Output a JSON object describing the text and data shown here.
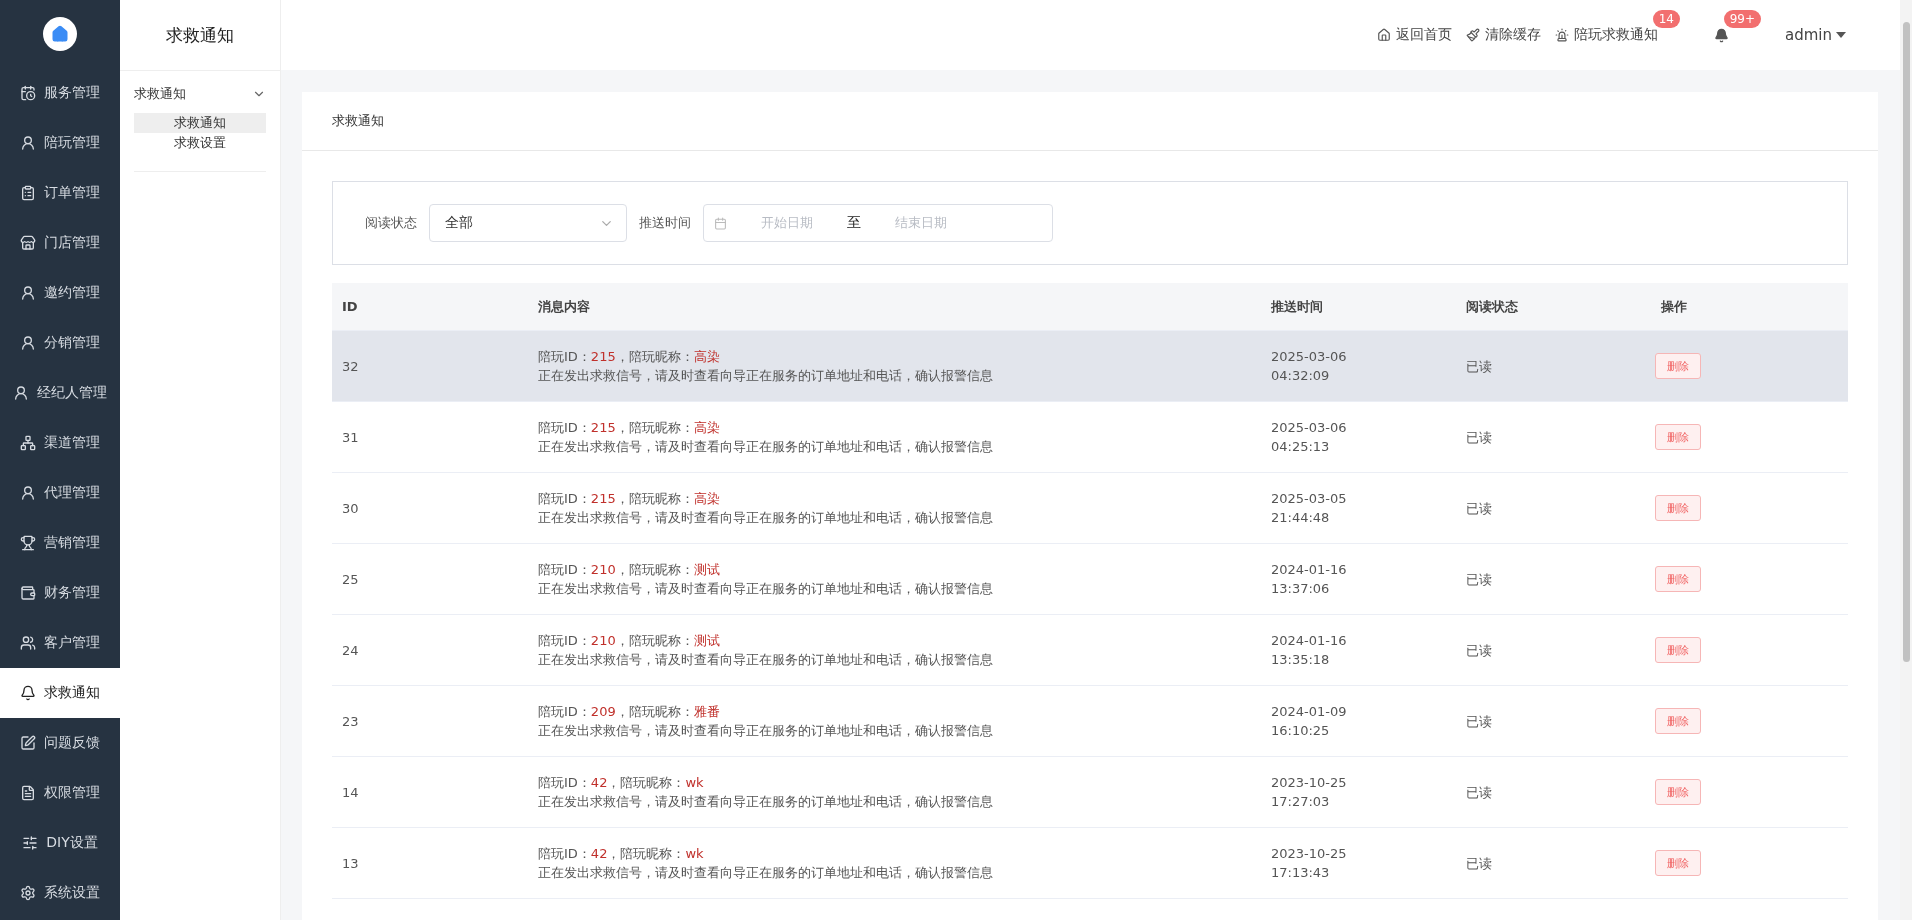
{
  "sidebar": {
    "items": [
      {
        "label": "服务管理",
        "selected": false
      },
      {
        "label": "陪玩管理",
        "selected": false
      },
      {
        "label": "订单管理",
        "selected": false
      },
      {
        "label": "门店管理",
        "selected": false
      },
      {
        "label": "邀约管理",
        "selected": false
      },
      {
        "label": "分销管理",
        "selected": false
      },
      {
        "label": "经纪人管理",
        "selected": false
      },
      {
        "label": "渠道管理",
        "selected": false
      },
      {
        "label": "代理管理",
        "selected": false
      },
      {
        "label": "营销管理",
        "selected": false
      },
      {
        "label": "财务管理",
        "selected": false
      },
      {
        "label": "客户管理",
        "selected": false
      },
      {
        "label": "求救通知",
        "selected": true
      },
      {
        "label": "问题反馈",
        "selected": false
      },
      {
        "label": "权限管理",
        "selected": false
      },
      {
        "label": "DIY设置",
        "selected": false
      },
      {
        "label": "系统设置",
        "selected": false
      }
    ]
  },
  "submenu": {
    "title": "求救通知",
    "group": {
      "label": "求救通知",
      "expanded": true,
      "children": [
        {
          "label": "求救通知",
          "selected": true
        },
        {
          "label": "求救设置",
          "selected": false
        }
      ]
    }
  },
  "header": {
    "links": [
      {
        "label": "返回首页"
      },
      {
        "label": "清除缓存"
      },
      {
        "label": "陪玩求救通知",
        "badge": "14"
      }
    ],
    "bell_badge": "99+",
    "user": "admin"
  },
  "card": {
    "title": "求救通知"
  },
  "filters": {
    "status_label": "阅读状态",
    "status_value": "全部",
    "time_label": "推送时间",
    "start_placeholder": "开始日期",
    "separator": "至",
    "end_placeholder": "结束日期"
  },
  "table": {
    "columns": [
      "ID",
      "消息内容",
      "推送时间",
      "阅读状态",
      "操作"
    ],
    "rows": [
      {
        "id": "32",
        "id_label": "陪玩ID：",
        "companion_id": "215",
        "nick_label": "，陪玩昵称：",
        "nickname": "高染",
        "message": "正在发出求救信号，请及时查看向导正在服务的订单地址和电话，确认报警信息",
        "date": "2025-03-06",
        "time": "04:32:09",
        "status": "已读",
        "action": "删除",
        "hovered": true
      },
      {
        "id": "31",
        "id_label": "陪玩ID：",
        "companion_id": "215",
        "nick_label": "，陪玩昵称：",
        "nickname": "高染",
        "message": "正在发出求救信号，请及时查看向导正在服务的订单地址和电话，确认报警信息",
        "date": "2025-03-06",
        "time": "04:25:13",
        "status": "已读",
        "action": "删除",
        "hovered": false
      },
      {
        "id": "30",
        "id_label": "陪玩ID：",
        "companion_id": "215",
        "nick_label": "，陪玩昵称：",
        "nickname": "高染",
        "message": "正在发出求救信号，请及时查看向导正在服务的订单地址和电话，确认报警信息",
        "date": "2025-03-05",
        "time": "21:44:48",
        "status": "已读",
        "action": "删除",
        "hovered": false
      },
      {
        "id": "25",
        "id_label": "陪玩ID：",
        "companion_id": "210",
        "nick_label": "，陪玩昵称：",
        "nickname": "测试",
        "message": "正在发出求救信号，请及时查看向导正在服务的订单地址和电话，确认报警信息",
        "date": "2024-01-16",
        "time": "13:37:06",
        "status": "已读",
        "action": "删除",
        "hovered": false
      },
      {
        "id": "24",
        "id_label": "陪玩ID：",
        "companion_id": "210",
        "nick_label": "，陪玩昵称：",
        "nickname": "测试",
        "message": "正在发出求救信号，请及时查看向导正在服务的订单地址和电话，确认报警信息",
        "date": "2024-01-16",
        "time": "13:35:18",
        "status": "已读",
        "action": "删除",
        "hovered": false
      },
      {
        "id": "23",
        "id_label": "陪玩ID：",
        "companion_id": "209",
        "nick_label": "，陪玩昵称：",
        "nickname": "雅番",
        "message": "正在发出求救信号，请及时查看向导正在服务的订单地址和电话，确认报警信息",
        "date": "2024-01-09",
        "time": "16:10:25",
        "status": "已读",
        "action": "删除",
        "hovered": false
      },
      {
        "id": "14",
        "id_label": "陪玩ID：",
        "companion_id": "42",
        "nick_label": "，陪玩昵称：",
        "nickname": "wk",
        "message": "正在发出求救信号，请及时查看向导正在服务的订单地址和电话，确认报警信息",
        "date": "2023-10-25",
        "time": "17:27:03",
        "status": "已读",
        "action": "删除",
        "hovered": false
      },
      {
        "id": "13",
        "id_label": "陪玩ID：",
        "companion_id": "42",
        "nick_label": "，陪玩昵称：",
        "nickname": "wk",
        "message": "正在发出求救信号，请及时查看向导正在服务的订单地址和电话，确认报警信息",
        "date": "2023-10-25",
        "time": "17:13:43",
        "status": "已读",
        "action": "删除",
        "hovered": false
      }
    ]
  }
}
